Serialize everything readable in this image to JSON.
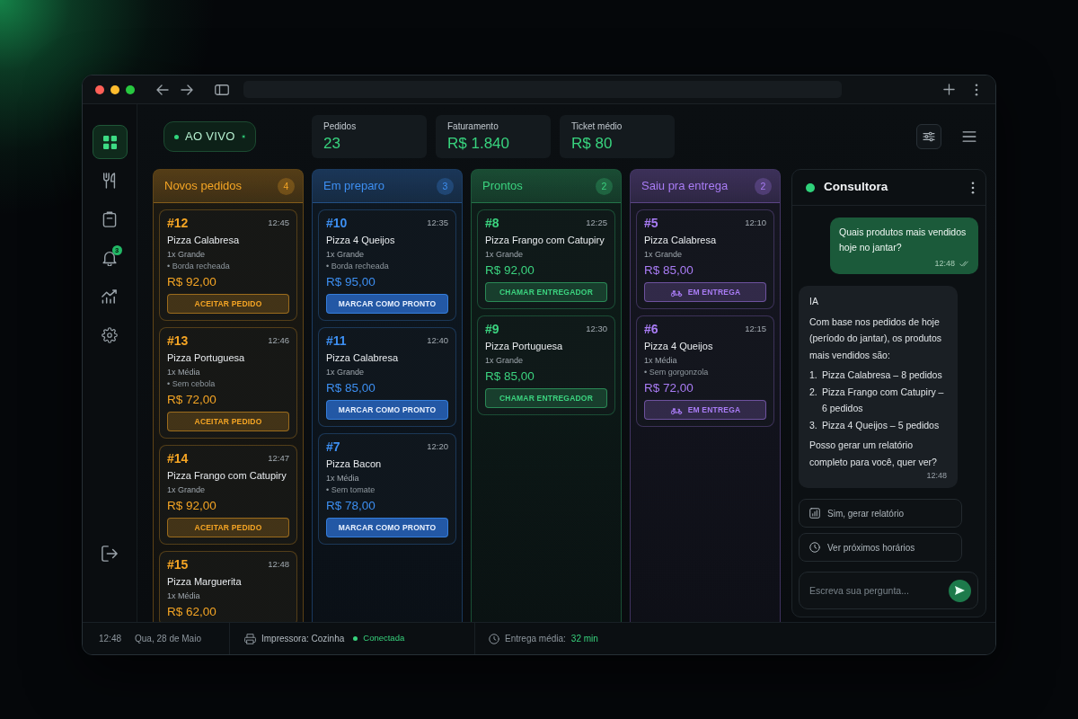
{
  "sidebar": {
    "items": [
      {
        "selected": true
      },
      {
        "selected": false
      },
      {
        "selected": false
      },
      {
        "selected": false,
        "badge": "3"
      },
      {
        "selected": false
      },
      {
        "selected": false
      }
    ]
  },
  "live": {
    "label": "AO VIVO"
  },
  "stats": [
    {
      "label": "Pedidos",
      "value": "23"
    },
    {
      "label": "Faturamento",
      "value": "R$ 1.840"
    },
    {
      "label": "Ticket médio",
      "value": "R$ 80"
    }
  ],
  "columns": [
    {
      "title": "Novos pedidos",
      "count": "4",
      "color": "#f5a524",
      "cards": [
        {
          "number": "#12",
          "time": "12:45",
          "product": "Pizza Calabresa",
          "size": "1x Grande",
          "note": "• Borda recheada",
          "price": "R$ 92,00",
          "action": {
            "kind": "soft",
            "label": "ACEITAR PEDIDO"
          }
        },
        {
          "number": "#13",
          "time": "12:46",
          "product": "Pizza Portuguesa",
          "size": "1x Média",
          "note": "• Sem cebola",
          "price": "R$ 72,00",
          "action": {
            "kind": "soft",
            "label": "ACEITAR PEDIDO"
          }
        },
        {
          "number": "#14",
          "time": "12:47",
          "product": "Pizza Frango com Catupiry",
          "size": "1x Grande",
          "price": "R$ 92,00",
          "action": {
            "kind": "soft",
            "label": "ACEITAR PEDIDO"
          }
        },
        {
          "number": "#15",
          "time": "12:48",
          "product": "Pizza Marguerita",
          "size": "1x Média",
          "price": "R$ 62,00"
        }
      ]
    },
    {
      "title": "Em preparo",
      "count": "3",
      "color": "#3d8ff2",
      "cards": [
        {
          "number": "#10",
          "time": "12:35",
          "product": "Pizza 4 Queijos",
          "size": "1x Grande",
          "note": "• Borda recheada",
          "price": "R$ 95,00",
          "action": {
            "kind": "solid",
            "label": "MARCAR COMO PRONTO"
          }
        },
        {
          "number": "#11",
          "time": "12:40",
          "product": "Pizza Calabresa",
          "size": "1x Grande",
          "price": "R$ 85,00",
          "action": {
            "kind": "solid",
            "label": "MARCAR COMO PRONTO"
          }
        },
        {
          "number": "#7",
          "time": "12:20",
          "product": "Pizza Bacon",
          "size": "1x Média",
          "note": "• Sem tomate",
          "price": "R$ 78,00",
          "action": {
            "kind": "solid",
            "label": "MARCAR COMO PRONTO"
          }
        }
      ]
    },
    {
      "title": "Prontos",
      "count": "2",
      "color": "#3bd37f",
      "cards": [
        {
          "number": "#8",
          "time": "12:25",
          "product": "Pizza Frango com Catupiry",
          "size": "1x Grande",
          "price": "R$ 92,00",
          "action": {
            "kind": "soft",
            "label": "CHAMAR ENTREGADOR"
          }
        },
        {
          "number": "#9",
          "time": "12:30",
          "product": "Pizza Portuguesa",
          "size": "1x Grande",
          "price": "R$ 85,00",
          "action": {
            "kind": "soft",
            "label": "CHAMAR ENTREGADOR"
          }
        }
      ]
    },
    {
      "title": "Saiu pra entrega",
      "count": "2",
      "color": "#a97cf5",
      "cards": [
        {
          "number": "#5",
          "time": "12:10",
          "product": "Pizza Calabresa",
          "size": "1x Grande",
          "price": "R$ 85,00",
          "action": {
            "kind": "delivery",
            "label": "EM ENTREGA"
          }
        },
        {
          "number": "#6",
          "time": "12:15",
          "product": "Pizza 4 Queijos",
          "size": "1x Média",
          "note": "• Sem gorgonzola",
          "price": "R$ 72,00",
          "action": {
            "kind": "delivery",
            "label": "EM ENTREGA"
          }
        }
      ]
    }
  ],
  "chat": {
    "title": "Consultora",
    "online": true,
    "messages": [
      {
        "kind": "user",
        "text": "Quais produtos mais vendidos hoje no jantar?",
        "time": "12:48",
        "read": true
      },
      {
        "kind": "assistant",
        "sender": "IA",
        "intro": "Com base nos pedidos de hoje (período do jantar), os produtos mais vendidos são:",
        "list": [
          {
            "number": "1.",
            "text": "Pizza Calabresa – 8 pedidos"
          },
          {
            "number": "2.",
            "text": "Pizza Frango com Catupiry – 6 pedidos"
          },
          {
            "number": "3.",
            "text": "Pizza 4 Queijos – 5 pedidos"
          }
        ],
        "outro": "Posso gerar um relatório completo para você, quer ver?",
        "time": "12:48"
      }
    ],
    "suggestions": [
      {
        "label": "Sim, gerar relatório"
      },
      {
        "label": "Ver próximos horários"
      }
    ],
    "input": {
      "placeholder": "Escreva sua pergunta..."
    }
  },
  "status_bar": {
    "time": "12:48",
    "date": "Qua, 28 de Maio",
    "printer": "Impressora: Cozinha",
    "printer_status": "Conectada",
    "connected": true,
    "delivery_label": "Entrega média:",
    "delivery_time": "32 min"
  }
}
